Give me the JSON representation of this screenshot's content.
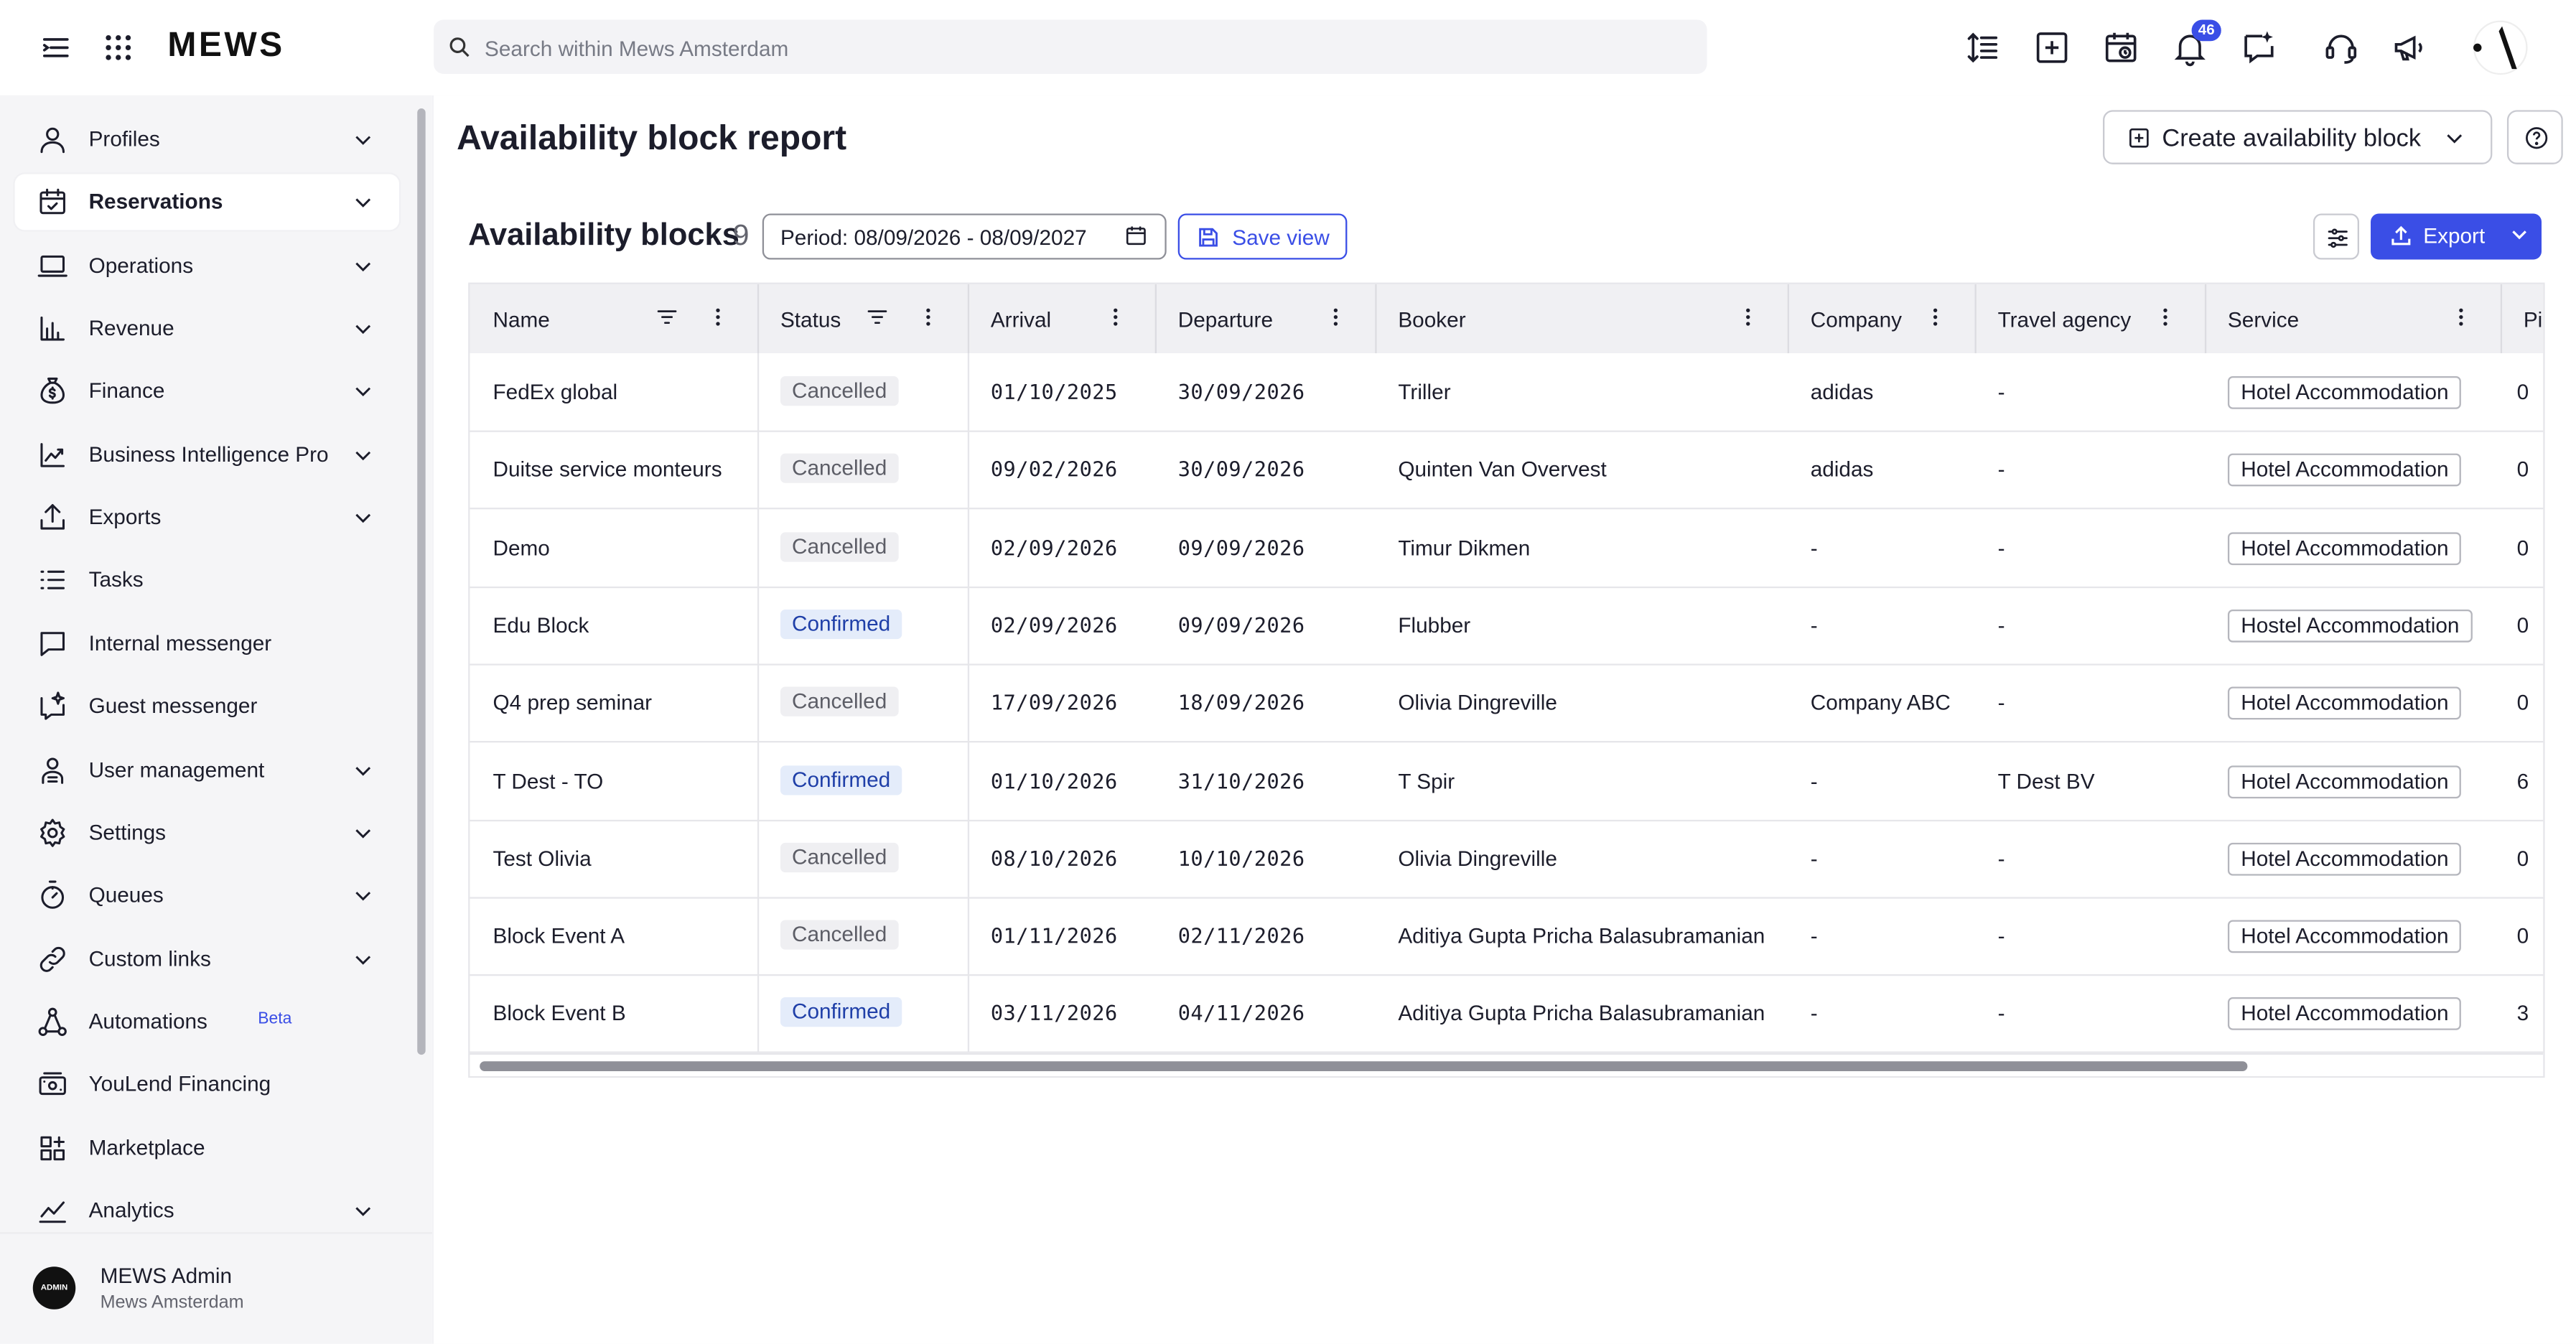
{
  "app": {
    "logo": "MEWS",
    "search_placeholder": "Search within Mews Amsterdam",
    "notification_count": "46"
  },
  "sidebar": {
    "items": [
      {
        "label": "Profiles",
        "icon": "user-icon",
        "chevron": true
      },
      {
        "label": "Reservations",
        "icon": "calendar-check-icon",
        "chevron": true,
        "active": true
      },
      {
        "label": "Operations",
        "icon": "laptop-icon",
        "chevron": true
      },
      {
        "label": "Revenue",
        "icon": "bar-chart-icon",
        "chevron": true
      },
      {
        "label": "Finance",
        "icon": "money-bag-icon",
        "chevron": true
      },
      {
        "label": "Business Intelligence Pro",
        "icon": "trend-chart-icon",
        "chevron": true
      },
      {
        "label": "Exports",
        "icon": "upload-icon",
        "chevron": true
      },
      {
        "label": "Tasks",
        "icon": "task-list-icon",
        "chevron": false
      },
      {
        "label": "Internal messenger",
        "icon": "chat-bubble-icon",
        "chevron": false
      },
      {
        "label": "Guest messenger",
        "icon": "sparkle-chat-icon",
        "chevron": false
      },
      {
        "label": "User management",
        "icon": "user-manage-icon",
        "chevron": true
      },
      {
        "label": "Settings",
        "icon": "gear-icon",
        "chevron": true
      },
      {
        "label": "Queues",
        "icon": "stopwatch-icon",
        "chevron": true
      },
      {
        "label": "Custom links",
        "icon": "link-icon",
        "chevron": true
      },
      {
        "label": "Automations",
        "icon": "automation-icon",
        "chevron": false,
        "badge": "Beta"
      },
      {
        "label": "YouLend Financing",
        "icon": "cash-icon",
        "chevron": false
      },
      {
        "label": "Marketplace",
        "icon": "grid-plus-icon",
        "chevron": false
      },
      {
        "label": "Analytics",
        "icon": "line-chart-icon",
        "chevron": true
      }
    ],
    "user": {
      "avatar_text": "ADMIN",
      "name": "MEWS Admin",
      "property": "Mews Amsterdam"
    }
  },
  "page": {
    "title": "Availability block report",
    "create_button": "Create availability block",
    "section_title": "Availability blocks",
    "count": "9",
    "period": "Period: 08/09/2026 - 08/09/2027",
    "save_view": "Save view",
    "export": "Export"
  },
  "table": {
    "columns": [
      "Name",
      "Status",
      "Arrival",
      "Departure",
      "Booker",
      "Company",
      "Travel agency",
      "Service",
      "Pi"
    ],
    "rows": [
      {
        "name": "FedEx global",
        "status": "Cancelled",
        "arrival": "01/10/2025",
        "departure": "30/09/2026",
        "booker": "Triller",
        "company": "adidas",
        "agency": "-",
        "service": "Hotel Accommodation",
        "pi": "0"
      },
      {
        "name": "Duitse service monteurs",
        "status": "Cancelled",
        "arrival": "09/02/2026",
        "departure": "30/09/2026",
        "booker": "Quinten Van Overvest",
        "company": "adidas",
        "agency": "-",
        "service": "Hotel Accommodation",
        "pi": "0"
      },
      {
        "name": "Demo",
        "status": "Cancelled",
        "arrival": "02/09/2026",
        "departure": "09/09/2026",
        "booker": "Timur Dikmen",
        "company": "-",
        "agency": "-",
        "service": "Hotel Accommodation",
        "pi": "0"
      },
      {
        "name": "Edu Block",
        "status": "Confirmed",
        "arrival": "02/09/2026",
        "departure": "09/09/2026",
        "booker": "Flubber",
        "company": "-",
        "agency": "-",
        "service": "Hostel Accommodation",
        "pi": "0"
      },
      {
        "name": "Q4 prep seminar",
        "status": "Cancelled",
        "arrival": "17/09/2026",
        "departure": "18/09/2026",
        "booker": "Olivia Dingreville",
        "company": "Company ABC",
        "agency": "-",
        "service": "Hotel Accommodation",
        "pi": "0"
      },
      {
        "name": "T Dest - TO",
        "status": "Confirmed",
        "arrival": "01/10/2026",
        "departure": "31/10/2026",
        "booker": "T Spir",
        "company": "-",
        "agency": "T Dest BV",
        "service": "Hotel Accommodation",
        "pi": "6"
      },
      {
        "name": "Test Olivia",
        "status": "Cancelled",
        "arrival": "08/10/2026",
        "departure": "10/10/2026",
        "booker": "Olivia Dingreville",
        "company": "-",
        "agency": "-",
        "service": "Hotel Accommodation",
        "pi": "0"
      },
      {
        "name": "Block Event A",
        "status": "Cancelled",
        "arrival": "01/11/2026",
        "departure": "02/11/2026",
        "booker": "Aditiya Gupta Pricha Balasubramanian",
        "company": "-",
        "agency": "-",
        "service": "Hotel Accommodation",
        "pi": "0"
      },
      {
        "name": "Block Event B",
        "status": "Confirmed",
        "arrival": "03/11/2026",
        "departure": "04/11/2026",
        "booker": "Aditiya Gupta Pricha Balasubramanian",
        "company": "-",
        "agency": "-",
        "service": "Hotel Accommodation",
        "pi": "3"
      }
    ]
  },
  "colors": {
    "accent": "#3a4ee6",
    "confirmed_bg": "#e4ecfa",
    "cancelled_bg": "#efeff2"
  }
}
